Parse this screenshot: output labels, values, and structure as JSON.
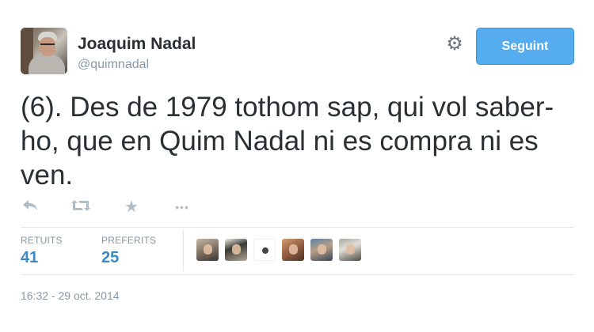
{
  "header": {
    "display_name": "Joaquim Nadal",
    "handle": "@quimnadal",
    "follow_button_label": "Seguint",
    "settings_icon": "gear-icon"
  },
  "tweet": {
    "text": "(6). Des de 1979 tothom sap, qui vol saber-ho, que en Quim Nadal ni es compra ni es ven."
  },
  "actions": {
    "reply_icon": "reply-icon",
    "retweet_icon": "retweet-icon",
    "favorite_icon": "star-icon",
    "more_icon": "more-icon"
  },
  "stats": {
    "retweets_label": "RETUITS",
    "retweets_count": "41",
    "favorites_label": "PREFERITS",
    "favorites_count": "25"
  },
  "timestamp": "16:32 - 29 oct. 2014",
  "colors": {
    "accent": "#55acee",
    "stat_value": "#3b88c3",
    "muted": "#8899a6",
    "text": "#292f33"
  }
}
